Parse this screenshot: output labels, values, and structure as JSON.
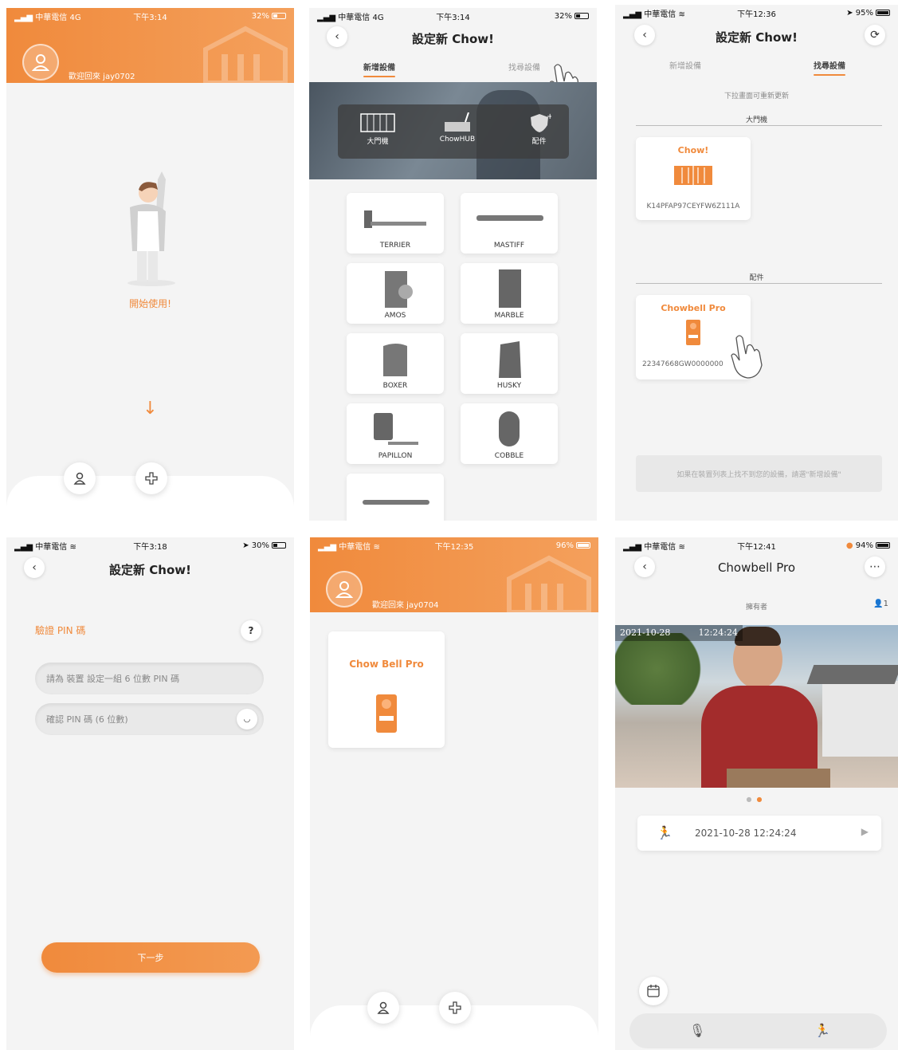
{
  "accent": "#f08a3c",
  "s1": {
    "status": {
      "carrier": "中華電信",
      "net": "4G",
      "time": "下午3:14",
      "battery": "32%"
    },
    "welcome": "歡迎回來 jay0702",
    "start_label": "開始使用!",
    "icons": [
      "user-icon",
      "add-device-icon"
    ]
  },
  "s2": {
    "status": {
      "carrier": "中華電信",
      "net": "4G",
      "time": "下午3:14",
      "battery": "32%"
    },
    "title": "設定新 Chow!",
    "tabs": [
      "新增設備",
      "找尋設備"
    ],
    "categories": [
      "大門機",
      "ChowHUB",
      "配件"
    ],
    "devices": [
      "TERRIER",
      "MASTIFF",
      "AMOS",
      "MARBLE",
      "BOXER",
      "HUSKY",
      "PAPILLON",
      "COBBLE"
    ]
  },
  "s3": {
    "status": {
      "carrier": "中華電信",
      "time": "下午12:36",
      "battery": "95%"
    },
    "title": "設定新 Chow!",
    "tabs": [
      "新增設備",
      "找尋設備"
    ],
    "hint": "下拉畫面可重新更新",
    "section_gate": "大門機",
    "gate_card": {
      "name": "Chow!",
      "serial": "K14PFAP97CEYFW6Z111A"
    },
    "section_acc": "配件",
    "acc_card": {
      "name": "Chowbell Pro",
      "serial": "22347668GW0000000"
    },
    "notice": "如果在裝置列表上找不到您的設備，請選\"新增設備\""
  },
  "s4": {
    "status": {
      "carrier": "中華電信",
      "time": "下午3:18",
      "battery": "30%"
    },
    "title": "設定新 Chow!",
    "pin_label": "驗證 PIN 碼",
    "help": "?",
    "pin_placeholder": "請為 裝置 設定一組 6 位數 PIN 碼",
    "confirm_placeholder": "確認 PIN 碼 (6 位數)",
    "next": "下一步"
  },
  "s5": {
    "status": {
      "carrier": "中華電信",
      "time": "下午12:35",
      "battery": "96%"
    },
    "welcome": "歡迎回來 jay0704",
    "device_name": "Chow Bell Pro"
  },
  "s6": {
    "status": {
      "carrier": "中華電信",
      "time": "下午12:41",
      "battery": "94%"
    },
    "title": "Chowbell Pro",
    "owner_label": "擁有者",
    "owner_count": "1",
    "snapshot_date": "2021-10-28",
    "snapshot_time": "12:24:24",
    "event_time": "2021-10-28 12:24:24"
  }
}
